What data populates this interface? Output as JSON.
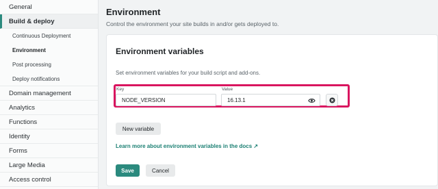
{
  "sidebar": {
    "items_top": [
      "General"
    ],
    "group": "Build & deploy",
    "sub_items": [
      "Continuous Deployment",
      "Environment",
      "Post processing",
      "Deploy notifications"
    ],
    "active_sub": "Environment",
    "items_bottom": [
      "Domain management",
      "Analytics",
      "Functions",
      "Identity",
      "Forms",
      "Large Media",
      "Access control"
    ]
  },
  "header": {
    "title": "Environment",
    "description": "Control the environment your site builds in and/or gets deployed to."
  },
  "card": {
    "title": "Environment variables",
    "description": "Set environment variables for your build script and add-ons.",
    "key_label": "Key",
    "value_label": "Value",
    "key_value": "NODE_VERSION",
    "value_value": "16.13.1",
    "new_variable_label": "New variable",
    "docs_link": "Learn more about environment variables in the docs ↗",
    "save_label": "Save",
    "cancel_label": "Cancel"
  },
  "colors": {
    "accent": "#2b8a7e",
    "highlight": "#d9155f"
  },
  "icons": {
    "reveal": "eye-icon",
    "remove": "remove-icon"
  }
}
